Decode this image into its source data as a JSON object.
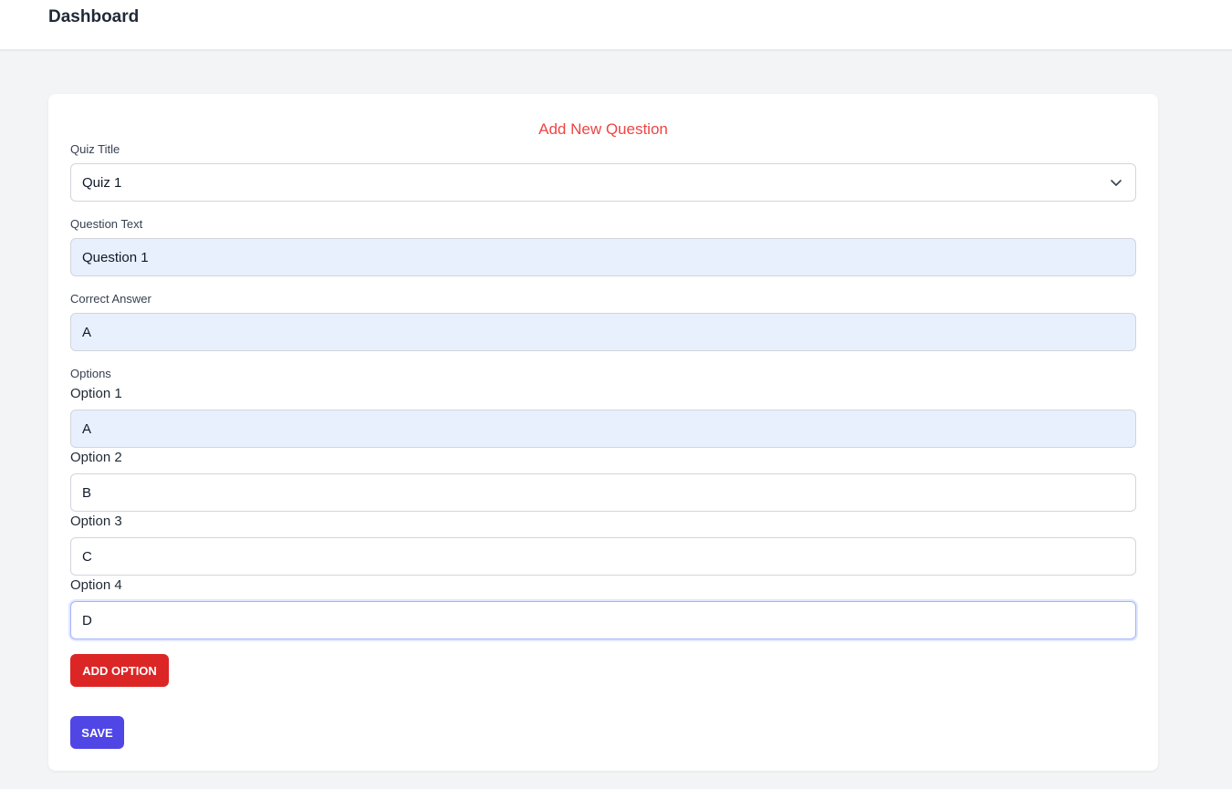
{
  "header": {
    "title": "Dashboard"
  },
  "form": {
    "heading": "Add New Question",
    "quiz_title": {
      "label": "Quiz Title",
      "value": "Quiz 1"
    },
    "question_text": {
      "label": "Question Text",
      "value": "Question 1"
    },
    "correct_answer": {
      "label": "Correct Answer",
      "value": "A"
    },
    "options_label": "Options",
    "options": [
      {
        "label": "Option 1",
        "value": "A"
      },
      {
        "label": "Option 2",
        "value": "B"
      },
      {
        "label": "Option 3",
        "value": "C"
      },
      {
        "label": "Option 4",
        "value": "D"
      }
    ],
    "add_option_label": "ADD OPTION",
    "save_label": "SAVE"
  },
  "colors": {
    "heading": "#ef4444",
    "add_option_button": "#dc2626",
    "save_button": "#4f46e5",
    "filled_field": "#e8f0fe"
  }
}
